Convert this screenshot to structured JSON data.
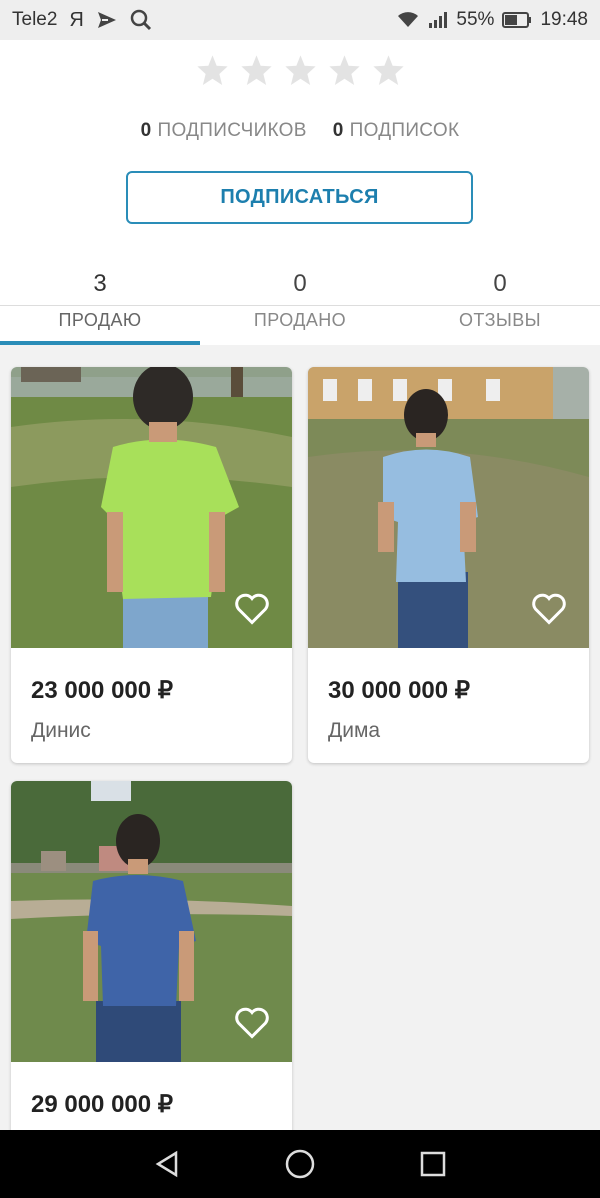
{
  "status_bar": {
    "carrier": "Tele2",
    "yandex": "Я",
    "battery_percent": "55%",
    "time": "19:48",
    "icons": [
      "yandex-icon",
      "send-icon",
      "search-icon",
      "wifi-icon",
      "signal-icon",
      "battery-icon"
    ]
  },
  "profile": {
    "rating": 0,
    "rating_max": 5,
    "followers_count": "0",
    "followers_label": "ПОДПИСЧИКОВ",
    "following_count": "0",
    "following_label": "ПОДПИСОК",
    "subscribe_label": "ПОДПИСАТЬСЯ"
  },
  "tabs": [
    {
      "count": "3",
      "label": "ПРОДАЮ",
      "active": true
    },
    {
      "count": "0",
      "label": "ПРОДАНО",
      "active": false
    },
    {
      "count": "0",
      "label": "ОТЗЫВЫ",
      "active": false
    }
  ],
  "listings": [
    {
      "price": "23 000 000 ₽",
      "seller": "Динис"
    },
    {
      "price": "30 000 000 ₽",
      "seller": "Дима"
    },
    {
      "price": "29 000 000 ₽",
      "seller": ""
    }
  ],
  "colors": {
    "accent": "#2a8db8",
    "star_empty": "#e3e3e3"
  }
}
